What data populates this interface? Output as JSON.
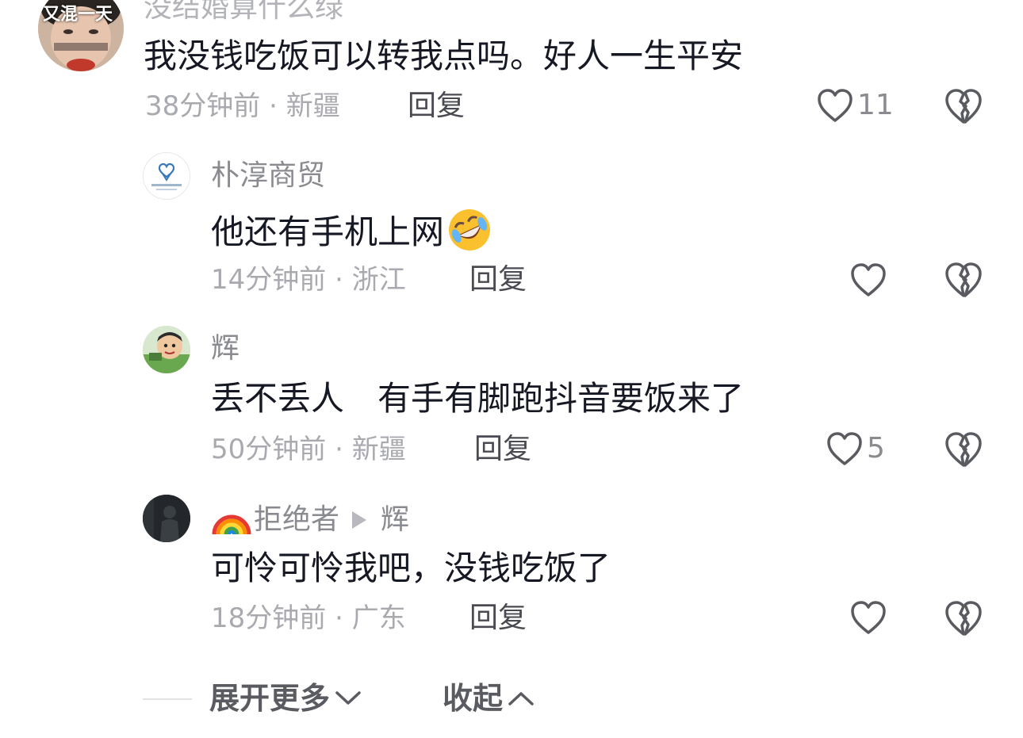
{
  "comments": [
    {
      "name": "没结婚算什么绿",
      "avatar_text": "又混一天",
      "text": "我没钱吃饭可以转我点吗。好人一生平安",
      "time": "38分钟前",
      "location": "新疆",
      "reply_label": "回复",
      "likes": "11"
    },
    {
      "name": "朴淳商贸",
      "text": "他还有手机上网",
      "time": "14分钟前",
      "location": "浙江",
      "reply_label": "回复",
      "likes": ""
    },
    {
      "name": "辉",
      "text": "丢不丢人　有手有脚跑抖音要饭来了",
      "time": "50分钟前",
      "location": "新疆",
      "reply_label": "回复",
      "likes": "5"
    },
    {
      "name": "拒绝者",
      "reply_to": "辉",
      "text": "可怜可怜我吧，没钱吃饭了",
      "time": "18分钟前",
      "location": "广东",
      "reply_label": "回复",
      "likes": ""
    }
  ],
  "footer": {
    "expand_label": "展开更多",
    "collapse_label": "收起"
  },
  "icons": {
    "like": "heart-outline-icon",
    "dislike": "broken-heart-icon",
    "emoji": "rolling-on-floor-laughing-emoji",
    "rainbow": "rainbow-emoji"
  },
  "colors": {
    "text": "#161823",
    "secondary": "#8a8b91",
    "meta": "#a9aab0",
    "icon": "#5a5b61"
  }
}
